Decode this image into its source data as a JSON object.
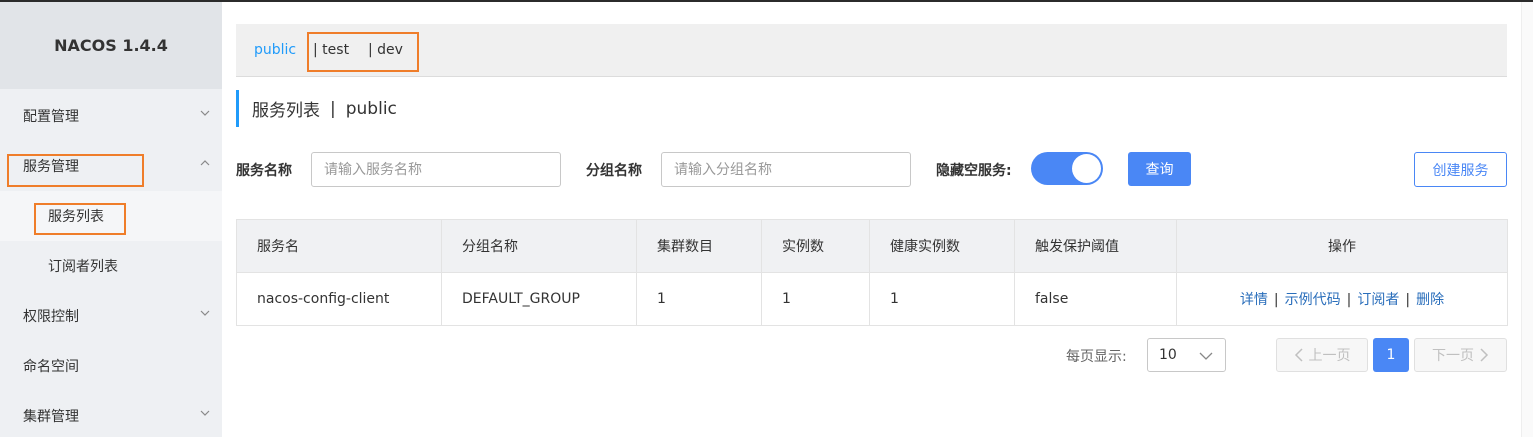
{
  "app": {
    "brand": "NACOS 1.4.4"
  },
  "sidebar": {
    "items": [
      {
        "label": "配置管理",
        "expanded": false
      },
      {
        "label": "服务管理",
        "expanded": true
      },
      {
        "label": "权限控制",
        "expanded": false
      },
      {
        "label": "命名空间"
      },
      {
        "label": "集群管理",
        "expanded": false
      }
    ],
    "sub_items": [
      {
        "label": "服务列表",
        "active": true
      },
      {
        "label": "订阅者列表",
        "active": false
      }
    ]
  },
  "namespaces": {
    "active": "public",
    "others": [
      "| test",
      "| dev"
    ]
  },
  "page": {
    "title": "服务列表",
    "title_sep": "|",
    "title_ns": "public"
  },
  "filters": {
    "service_name_label": "服务名称",
    "service_name_placeholder": "请输入服务名称",
    "group_name_label": "分组名称",
    "group_name_placeholder": "请输入分组名称",
    "hide_empty_label": "隐藏空服务:",
    "hide_empty_on": true,
    "query_button": "查询",
    "create_button": "创建服务"
  },
  "table": {
    "headers": [
      "服务名",
      "分组名称",
      "集群数目",
      "实例数",
      "健康实例数",
      "触发保护阈值",
      "操作"
    ],
    "rows": [
      {
        "service": "nacos-config-client",
        "group": "DEFAULT_GROUP",
        "clusters": "1",
        "instances": "1",
        "healthy": "1",
        "threshold": "false",
        "ops": [
          "详情",
          "示例代码",
          "订阅者",
          "删除"
        ]
      }
    ]
  },
  "pagination": {
    "per_page_label": "每页显示:",
    "per_page": "10",
    "prev": "上一页",
    "next": "下一页",
    "current": "1"
  },
  "colors": {
    "accent": "#4a87f5",
    "highlight": "#ef7d2a",
    "link": "#2a6ebb",
    "ns_active": "#209bfa"
  }
}
